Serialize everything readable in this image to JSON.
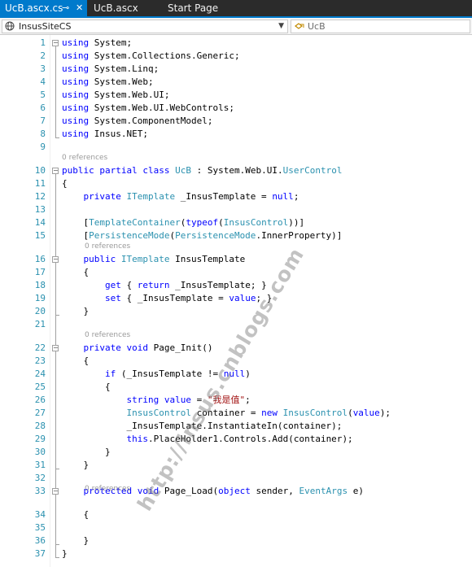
{
  "tabs": [
    {
      "label": "UcB.ascx.cs",
      "active": true
    },
    {
      "label": "UcB.ascx",
      "active": false
    },
    {
      "label": "Start Page",
      "active": false
    }
  ],
  "tab_icons": {
    "pin": "pin-icon",
    "close": "close-icon"
  },
  "navbar": {
    "class_combo": "InsusSiteCS",
    "member_combo": "UcB"
  },
  "code_lens": {
    "label": "0 references"
  },
  "watermark": "http://insus.cnblogs.com",
  "colors": {
    "keyword": "#0000ff",
    "type": "#2b91af",
    "string": "#a31515",
    "line_number": "#2b91af",
    "tab_active": "#007acc",
    "tab_bar": "#2b2b2b"
  },
  "lines": [
    {
      "n": "1",
      "code": "using System;"
    },
    {
      "n": "2",
      "code": "using System.Collections.Generic;"
    },
    {
      "n": "3",
      "code": "using System.Linq;"
    },
    {
      "n": "4",
      "code": "using System.Web;"
    },
    {
      "n": "5",
      "code": "using System.Web.UI;"
    },
    {
      "n": "6",
      "code": "using System.Web.UI.WebControls;"
    },
    {
      "n": "7",
      "code": "using System.ComponentModel;"
    },
    {
      "n": "8",
      "code": "using Insus.NET;"
    },
    {
      "n": "9",
      "code": ""
    },
    {
      "n": "10",
      "code": "public partial class UcB : System.Web.UI.UserControl"
    },
    {
      "n": "11",
      "code": "{"
    },
    {
      "n": "12",
      "code": "    private ITemplate _InsusTemplate = null;"
    },
    {
      "n": "13",
      "code": ""
    },
    {
      "n": "14",
      "code": "    [TemplateContainer(typeof(InsusControl))]"
    },
    {
      "n": "15",
      "code": "    [PersistenceMode(PersistenceMode.InnerProperty)]"
    },
    {
      "n": "16",
      "code": "    public ITemplate InsusTemplate"
    },
    {
      "n": "17",
      "code": "    {"
    },
    {
      "n": "18",
      "code": "        get { return _InsusTemplate; }"
    },
    {
      "n": "19",
      "code": "        set { _InsusTemplate = value; }"
    },
    {
      "n": "20",
      "code": "    }"
    },
    {
      "n": "21",
      "code": ""
    },
    {
      "n": "22",
      "code": "    private void Page_Init()"
    },
    {
      "n": "23",
      "code": "    {"
    },
    {
      "n": "24",
      "code": "        if (_InsusTemplate != null)"
    },
    {
      "n": "25",
      "code": "        {"
    },
    {
      "n": "26",
      "code": "            string value = \"我是值\";"
    },
    {
      "n": "27",
      "code": "            InsusControl container = new InsusControl(value);"
    },
    {
      "n": "28",
      "code": "            _InsusTemplate.InstantiateIn(container);"
    },
    {
      "n": "29",
      "code": "            this.PlaceHolder1.Controls.Add(container);"
    },
    {
      "n": "30",
      "code": "        }"
    },
    {
      "n": "31",
      "code": "    }"
    },
    {
      "n": "32",
      "code": ""
    },
    {
      "n": "33",
      "code": "    protected void Page_Load(object sender, EventArgs e)"
    },
    {
      "n": "34",
      "code": "    {"
    },
    {
      "n": "35",
      "code": ""
    },
    {
      "n": "36",
      "code": "    }"
    },
    {
      "n": "37",
      "code": "}"
    }
  ]
}
